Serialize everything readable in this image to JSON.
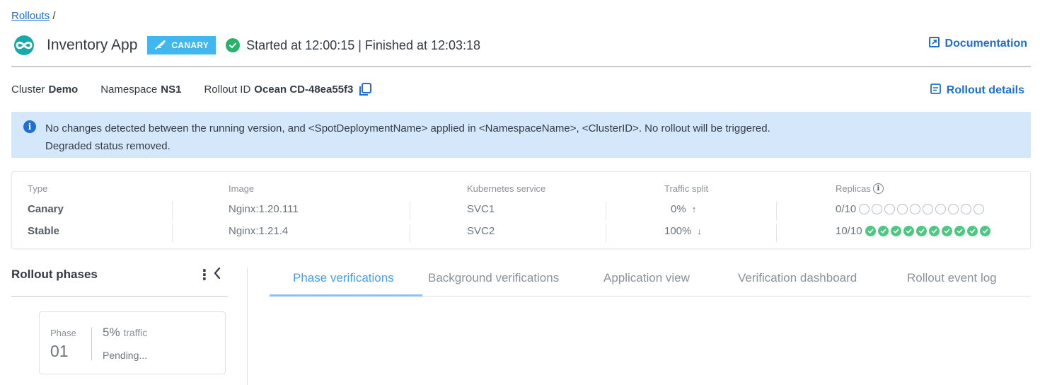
{
  "breadcrumb": {
    "link": "Rollouts",
    "separator": "/"
  },
  "header": {
    "app_title": "Inventory App",
    "badge": "CANARY",
    "status": "Started at 12:00:15 | Finished  at 12:03:18",
    "doc_link": "Documentation"
  },
  "meta": {
    "cluster_label": "Cluster",
    "cluster_value": "Demo",
    "namespace_label": "Namespace",
    "namespace_value": "NS1",
    "rollout_id_label": "Rollout ID",
    "rollout_id_value": "Ocean CD-48ea55f3",
    "details_link": "Rollout details"
  },
  "banner": {
    "line1": "No changes detected between the running version, and <SpotDeploymentName> applied in <NamespaceName>, <ClusterID>. No rollout will be triggered.",
    "line2": "Degraded status removed."
  },
  "summary": {
    "headers": [
      "Type",
      "Image",
      "Kubernetes service",
      "Traffic split",
      "Replicas"
    ],
    "rows": [
      {
        "type": "Canary",
        "image": "Nginx:1.20.111",
        "service": "SVC1",
        "traffic": "0%",
        "traffic_arrow": "↑",
        "replicas": "0/10",
        "ready": 0,
        "total": 10
      },
      {
        "type": "Stable",
        "image": "Nginx:1.21.4",
        "service": "SVC2",
        "traffic": "100%",
        "traffic_arrow": "↓",
        "replicas": "10/10",
        "ready": 10,
        "total": 10
      }
    ]
  },
  "phases": {
    "title": "Rollout phases",
    "card": {
      "label": "Phase",
      "number": "01",
      "traffic_value": "5%",
      "traffic_unit": "traffic",
      "status": "Pending..."
    }
  },
  "tabs": [
    "Phase verifications",
    "Background verifications",
    "Application view",
    "Verification dashboard",
    "Rollout event log"
  ],
  "active_tab": "Phase verifications",
  "colors": {
    "link": "#1f6fd1",
    "badge": "#41b6ef",
    "success": "#26b36a",
    "replica_ready": "#4bc983",
    "banner_bg": "#d5e8fb",
    "active_tab": "#4a9ee6"
  },
  "icons": {
    "app_logo": "infinity-logo-icon",
    "badge_icon": "feather-icon",
    "status_icon": "check-circle-icon",
    "doc_icon": "external-link-icon",
    "copy_icon": "copy-icon",
    "details_icon": "document-icon",
    "info_icon": "info-icon",
    "menu_icon": "kebab-menu-icon",
    "collapse_icon": "chevron-left-icon"
  }
}
